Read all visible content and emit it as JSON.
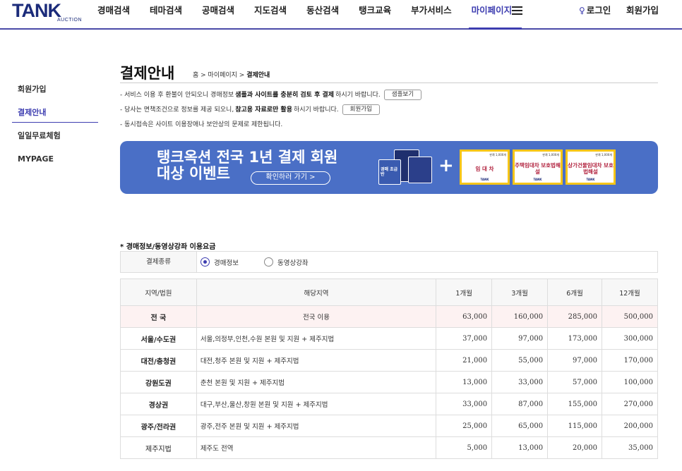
{
  "header": {
    "logo_text": "TANK",
    "logo_sub": "AUCTION",
    "nav": [
      {
        "label": "경매검색"
      },
      {
        "label": "테마검색"
      },
      {
        "label": "공매검색"
      },
      {
        "label": "지도검색"
      },
      {
        "label": "동산검색"
      },
      {
        "label": "탱크교육"
      },
      {
        "label": "부가서비스"
      },
      {
        "label": "마이페이지"
      }
    ],
    "active_nav": "마이페이지",
    "login_label": "로그인",
    "signup_label": "회원가입"
  },
  "sidebar": {
    "items": [
      {
        "label": "회원가입"
      },
      {
        "label": "결제안내"
      },
      {
        "label": "일일무료체험"
      },
      {
        "label": "MYPAGE"
      }
    ],
    "active": "결제안내"
  },
  "page": {
    "title": "결제안내",
    "breadcrumb_prefix": "홈 > 마이페이지 > ",
    "breadcrumb_current": "결제안내"
  },
  "notes": {
    "n1_a": "- 서비스 이용 후 환불이 안되오니 경매정보",
    "n1_b": "샘플과 사이트를 충분히 검토 후 결제",
    "n1_c": "하시기 바랍니다.",
    "n1_btn": "샘플보기",
    "n2_a": "- 당사는 면책조건으로 정보를 제공 되오니,",
    "n2_b": "참고용 자료로만 활용",
    "n2_c": "하시기 바랍니다.",
    "n2_btn": "회원가입",
    "n3": "- 동시접속은 사이트 이용장애나 보안상의 문제로 제한됩니다."
  },
  "banner": {
    "line1": "탱크옥션 전국 1년 결제 회원",
    "line2": "대상 이벤트",
    "button": "확인하러 가기 >",
    "plus": "+",
    "book1": "경매 초급반",
    "cards": [
      {
        "text": "임 대 차",
        "tag": "판례 1,000개",
        "brand": "TANK"
      },
      {
        "text": "주택임대차 보호법해설",
        "tag": "판례 1,000개",
        "brand": "TANK"
      },
      {
        "text": "상가건물임대차 보호법해설",
        "tag": "판례 1,000개",
        "brand": "TANK"
      }
    ],
    "colors": {
      "background": "#4a6fc6",
      "card_border": "#f5c518"
    }
  },
  "pricing": {
    "section_title": "경매정보/동영상강좌 이용요금",
    "type_label": "결제종류",
    "options": [
      {
        "label": "경매정보",
        "checked": true
      },
      {
        "label": "동영상강좌",
        "checked": false
      }
    ],
    "headers": [
      "지역/법원",
      "해당지역",
      "1개월",
      "3개월",
      "6개월",
      "12개월"
    ],
    "rows": [
      {
        "region": "전 국",
        "area": "전국 이용",
        "m1": "63,000",
        "m3": "160,000",
        "m6": "285,000",
        "m12": "500,000"
      },
      {
        "region": "서울/수도권",
        "area": "서울,의정부,인천,수원 본원 및 지원 + 제주지법",
        "m1": "37,000",
        "m3": "97,000",
        "m6": "173,000",
        "m12": "300,000"
      },
      {
        "region": "대전/충청권",
        "area": "대전,청주 본원 및 지원 + 제주지법",
        "m1": "21,000",
        "m3": "55,000",
        "m6": "97,000",
        "m12": "170,000"
      },
      {
        "region": "강원도권",
        "area": "춘천 본원 및 지원 + 제주지법",
        "m1": "13,000",
        "m3": "33,000",
        "m6": "57,000",
        "m12": "100,000"
      },
      {
        "region": "경상권",
        "area": "대구,부산,울산,창원 본원 및 지원 + 제주지법",
        "m1": "33,000",
        "m3": "87,000",
        "m6": "155,000",
        "m12": "270,000"
      },
      {
        "region": "광주/전라권",
        "area": "광주,전주 본원 및 지원 + 제주지법",
        "m1": "25,000",
        "m3": "65,000",
        "m6": "115,000",
        "m12": "200,000"
      },
      {
        "region": "제주지법",
        "area": "제주도 전역",
        "m1": "5,000",
        "m3": "13,000",
        "m6": "20,000",
        "m12": "35,000"
      }
    ]
  }
}
